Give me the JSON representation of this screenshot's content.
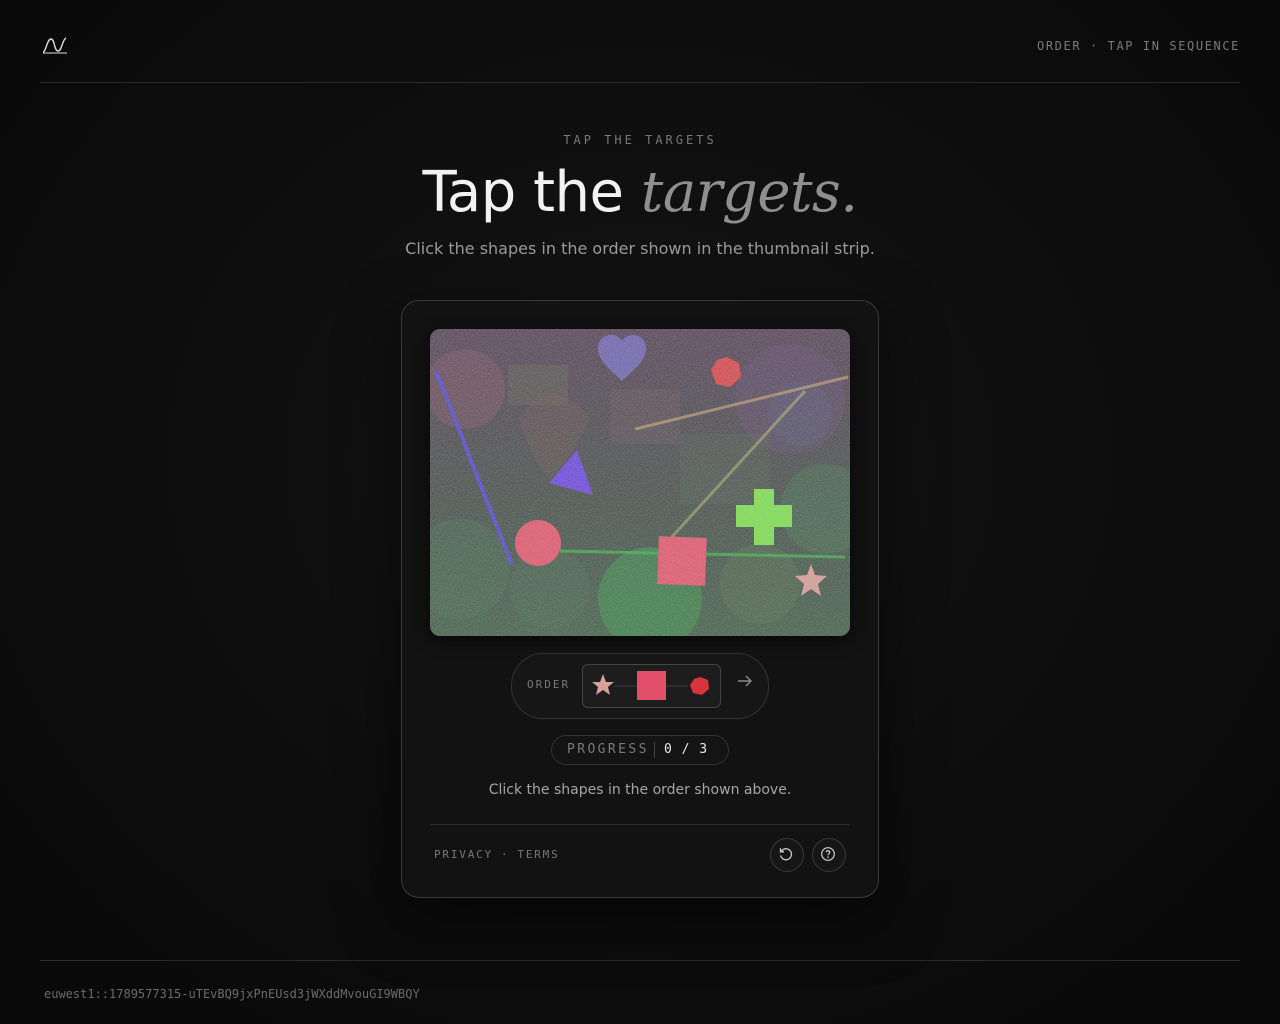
{
  "header": {
    "logo_icon": "wave-logo-icon",
    "mode_label": "ORDER · TAP IN SEQUENCE"
  },
  "hero": {
    "eyebrow": "TAP THE TARGETS",
    "title_plain": "Tap the",
    "title_emphasis": "targets.",
    "subtitle": "Click the shapes in the order shown in the thumbnail strip."
  },
  "challenge": {
    "canvas_shapes": [
      {
        "name": "heart-shape",
        "color": "#7468c4"
      },
      {
        "name": "hexagon-shape",
        "color": "#d8343c"
      },
      {
        "name": "triangle-shape",
        "color": "#6a35e0"
      },
      {
        "name": "cross-shape",
        "color": "#7fe045"
      },
      {
        "name": "circle-shape",
        "color": "#e24f6a"
      },
      {
        "name": "square-shape",
        "color": "#e24f6a"
      },
      {
        "name": "star-shape",
        "color": "#d8a098"
      }
    ],
    "order_label": "ORDER",
    "order_sequence": [
      {
        "name": "star-thumb",
        "color": "#d8a098"
      },
      {
        "name": "square-thumb",
        "color": "#e24f6a"
      },
      {
        "name": "hexagon-thumb",
        "color": "#d8343c"
      }
    ],
    "arrow_icon": "arrow-right-icon",
    "progress_label": "PROGRESS",
    "progress_value": "0 / 3",
    "hint": "Click the shapes in the order shown above."
  },
  "footer": {
    "privacy": "PRIVACY",
    "separator": "·",
    "terms": "TERMS",
    "reload_icon": "reload-icon",
    "help_icon": "help-icon"
  },
  "session": {
    "id": "euwest1::1789577315-uTEvBQ9jxPnEUsd3jWXddMvouGI9WBQY"
  }
}
